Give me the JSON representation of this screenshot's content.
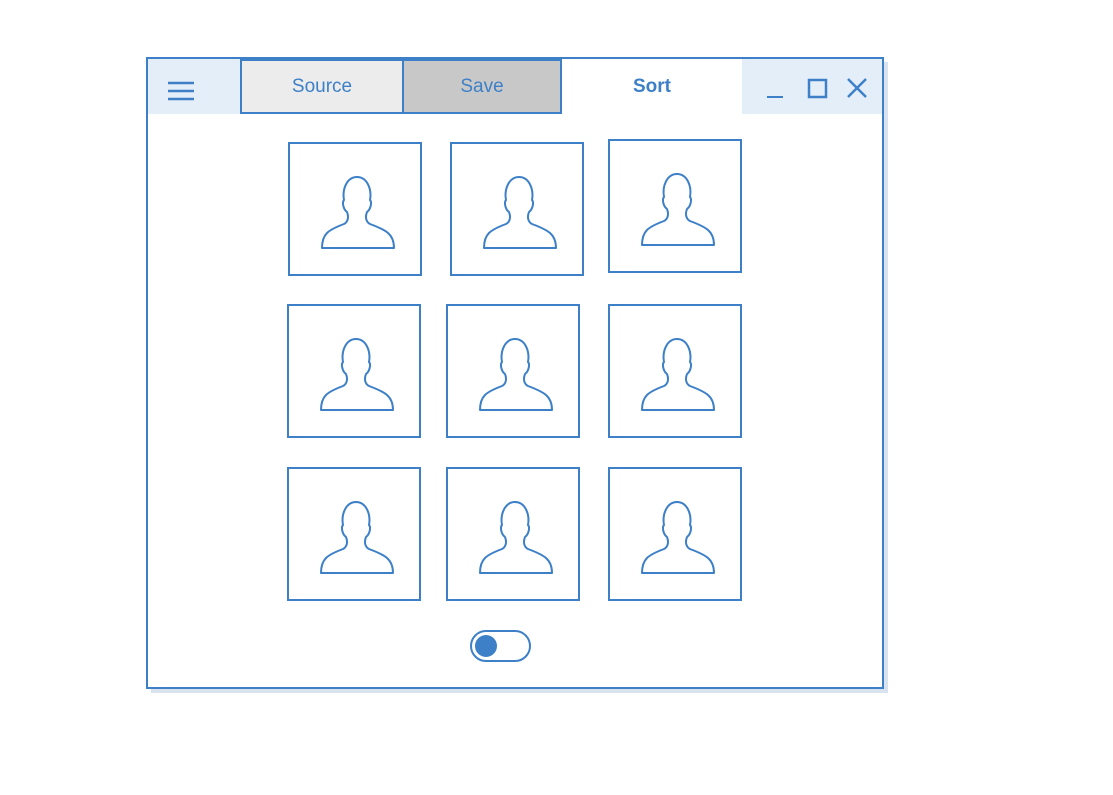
{
  "app": {
    "menu_icon": "hamburger-menu-icon",
    "tabs": [
      {
        "label": "Source",
        "state": "default"
      },
      {
        "label": "Save",
        "state": "pressed"
      },
      {
        "label": "Sort",
        "state": "active"
      }
    ],
    "window_controls": [
      "minimize-icon",
      "maximize-icon",
      "close-icon"
    ]
  },
  "gallery": {
    "tile_icon": "user-silhouette-icon",
    "tile_count": 9
  },
  "toggle": {
    "state": "off"
  },
  "colors": {
    "accent": "#3d80c8",
    "titlebar_bg": "#e4eef9",
    "tab_source_bg": "#ececec",
    "tab_save_bg": "#c8c8c8",
    "shadow": "#d9e3ef"
  }
}
